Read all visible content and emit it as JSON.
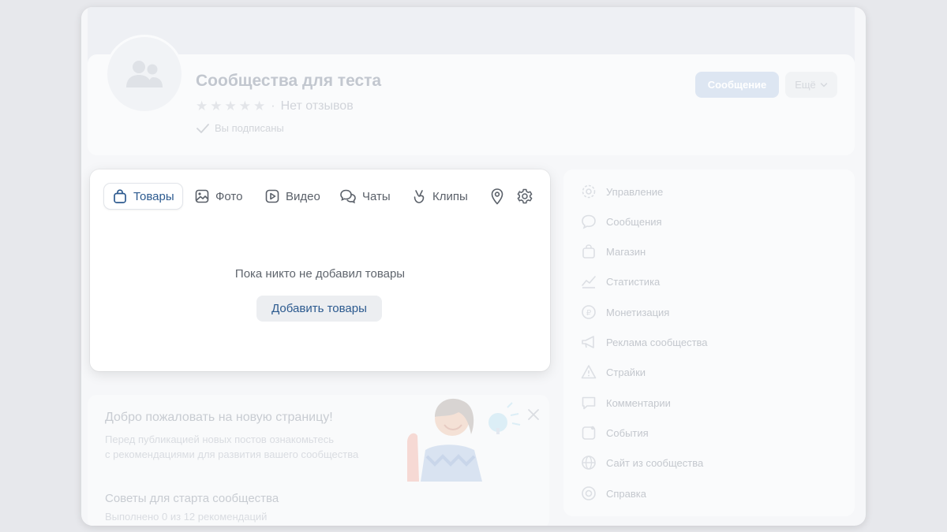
{
  "header": {
    "community_name": "Сообщества для теста",
    "reviews_text": "Нет отзывов",
    "rating_separator": "·",
    "subscribed_text": "Вы подписаны",
    "message_button": "Сообщение",
    "more_button": "Ещё"
  },
  "tabs": [
    {
      "label": "Товары",
      "icon": "bag-icon",
      "active": true
    },
    {
      "label": "Фото",
      "icon": "image-icon",
      "active": false
    },
    {
      "label": "Видео",
      "icon": "video-icon",
      "active": false
    },
    {
      "label": "Чаты",
      "icon": "chats-icon",
      "active": false
    },
    {
      "label": "Клипы",
      "icon": "clips-icon",
      "active": false
    }
  ],
  "tab_icons": [
    "location-icon",
    "gear-icon"
  ],
  "main": {
    "empty_text": "Пока никто не добавил товары",
    "add_button": "Добавить товары"
  },
  "sidebar": {
    "items": [
      {
        "label": "Управление",
        "icon": "gear-icon"
      },
      {
        "label": "Сообщения",
        "icon": "message-icon"
      },
      {
        "label": "Магазин",
        "icon": "bag-icon"
      },
      {
        "label": "Статистика",
        "icon": "chart-icon"
      },
      {
        "label": "Монетизация",
        "icon": "ruble-icon"
      },
      {
        "label": "Реклама сообщества",
        "icon": "megaphone-icon"
      },
      {
        "label": "Страйки",
        "icon": "warning-icon"
      },
      {
        "label": "Комментарии",
        "icon": "comment-icon"
      },
      {
        "label": "События",
        "icon": "event-icon"
      },
      {
        "label": "Сайт из сообщества",
        "icon": "globe-icon"
      },
      {
        "label": "Справка",
        "icon": "help-icon"
      }
    ]
  },
  "welcome": {
    "title": "Добро пожаловать на новую страницу!",
    "description_line1": "Перед публикацией новых постов ознакомьтесь",
    "description_line2": "с рекомендациями для развития вашего сообщества",
    "tips_title": "Советы для старта сообщества",
    "tips_progress": "Выполнено 0 из 12 рекомендаций"
  },
  "colors": {
    "accent": "#2c5a8f",
    "background": "#e7e8ec",
    "card": "#ffffff"
  }
}
